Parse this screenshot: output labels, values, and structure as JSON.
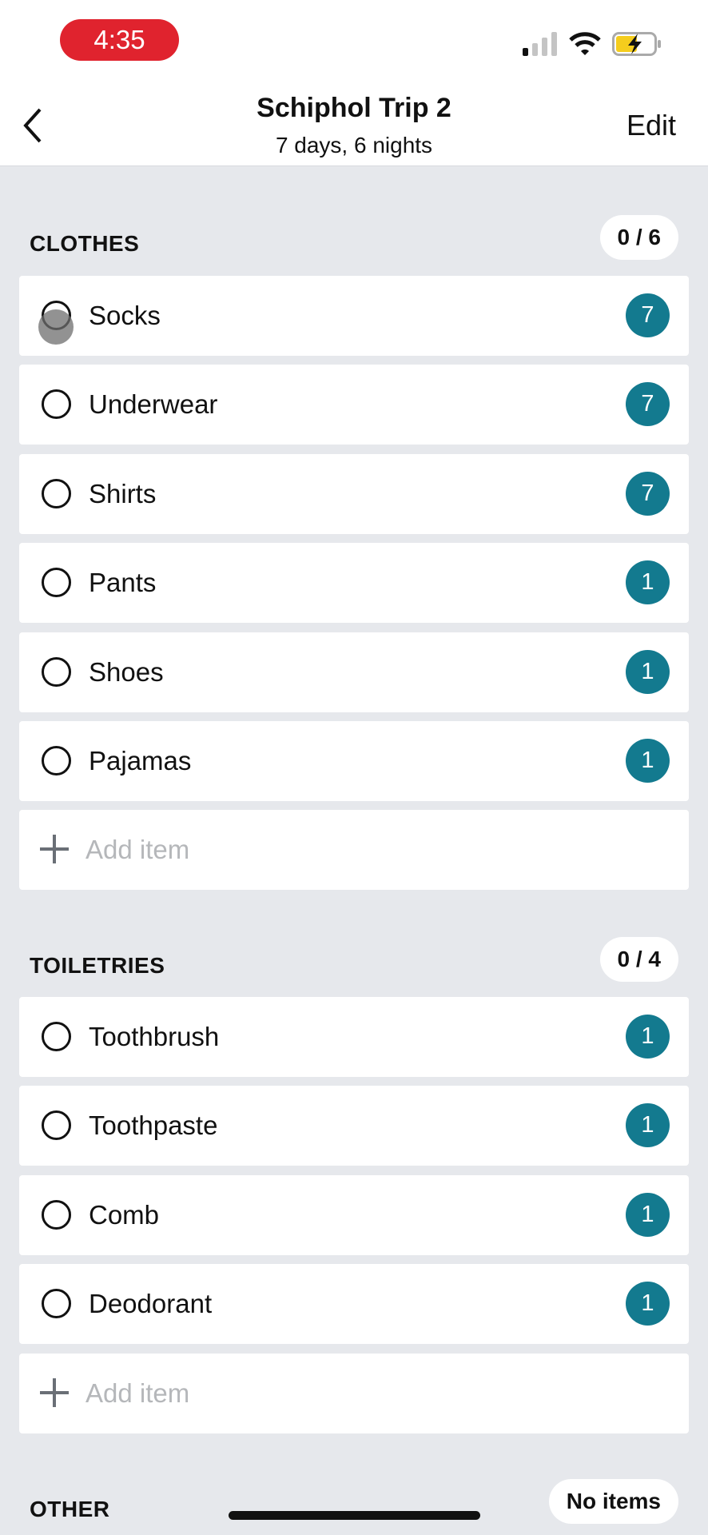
{
  "status_bar": {
    "time": "4:35",
    "icons": [
      "cellular-signal-icon",
      "wifi-icon",
      "battery-charging-icon"
    ],
    "time_pill_color": "#e0232e"
  },
  "header": {
    "title": "Schiphol Trip 2",
    "subtitle": "7 days, 6 nights",
    "edit_label": "Edit",
    "back_icon": "chevron-left-icon"
  },
  "accent_color": "#137a8f",
  "sections": [
    {
      "label": "CLOTHES",
      "count": "0 / 6",
      "items": [
        {
          "name": "Socks",
          "qty": "7"
        },
        {
          "name": "Underwear",
          "qty": "7"
        },
        {
          "name": "Shirts",
          "qty": "7"
        },
        {
          "name": "Pants",
          "qty": "1"
        },
        {
          "name": "Shoes",
          "qty": "1"
        },
        {
          "name": "Pajamas",
          "qty": "1"
        }
      ],
      "add_label": "Add item"
    },
    {
      "label": "TOILETRIES",
      "count": "0 / 4",
      "items": [
        {
          "name": "Toothbrush",
          "qty": "1"
        },
        {
          "name": "Toothpaste",
          "qty": "1"
        },
        {
          "name": "Comb",
          "qty": "1"
        },
        {
          "name": "Deodorant",
          "qty": "1"
        }
      ],
      "add_label": "Add item"
    },
    {
      "label": "OTHER",
      "count": "No items",
      "items": []
    }
  ]
}
